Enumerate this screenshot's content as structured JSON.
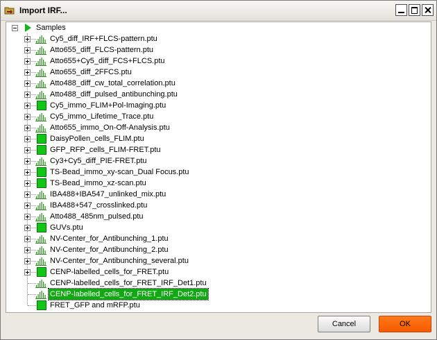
{
  "window": {
    "title": "Import IRF...",
    "icon": "folder-icon",
    "controls": [
      "minimize",
      "maximize",
      "close"
    ]
  },
  "tree": {
    "root": "Samples",
    "items": [
      {
        "label": "Cy5_diff_IRF+FLCS-pattern.ptu",
        "icon": "histogram-icon",
        "expandable": true
      },
      {
        "label": "Atto655_diff_FLCS-pattern.ptu",
        "icon": "histogram-icon",
        "expandable": true
      },
      {
        "label": "Atto655+Cy5_diff_FCS+FLCS.ptu",
        "icon": "histogram-icon",
        "expandable": true
      },
      {
        "label": "Atto655_diff_2FFCS.ptu",
        "icon": "histogram-icon",
        "expandable": true
      },
      {
        "label": "Atto488_diff_cw_total_correlation.ptu",
        "icon": "histogram-icon",
        "expandable": true
      },
      {
        "label": "Atto488_diff_pulsed_antibunching.ptu",
        "icon": "histogram-icon",
        "expandable": true
      },
      {
        "label": "Cy5_immo_FLIM+Pol-Imaging.ptu",
        "icon": "image-square-icon",
        "expandable": true
      },
      {
        "label": "Cy5_immo_Lifetime_Trace.ptu",
        "icon": "histogram-icon",
        "expandable": true
      },
      {
        "label": "Atto655_immo_On-Off-Analysis.ptu",
        "icon": "histogram-icon",
        "expandable": true
      },
      {
        "label": "DaisyPollen_cells_FLIM.ptu",
        "icon": "image-square-icon",
        "expandable": true
      },
      {
        "label": "GFP_RFP_cells_FLIM-FRET.ptu",
        "icon": "image-square-icon",
        "expandable": true
      },
      {
        "label": "Cy3+Cy5_diff_PIE-FRET.ptu",
        "icon": "histogram-icon",
        "expandable": true
      },
      {
        "label": "TS-Bead_immo_xy-scan_Dual Focus.ptu",
        "icon": "image-square-icon",
        "expandable": true
      },
      {
        "label": "TS-Bead_immo_xz-scan.ptu",
        "icon": "image-square-icon",
        "expandable": true
      },
      {
        "label": "IBA488+IBA547_unlinked_mix.ptu",
        "icon": "histogram-icon",
        "expandable": true
      },
      {
        "label": "IBA488+547_crosslinked.ptu",
        "icon": "histogram-icon",
        "expandable": true
      },
      {
        "label": "Atto488_485nm_pulsed.ptu",
        "icon": "histogram-icon",
        "expandable": true
      },
      {
        "label": "GUVs.ptu",
        "icon": "image-square-icon",
        "expandable": true
      },
      {
        "label": "NV-Center_for_Antibunching_1.ptu",
        "icon": "histogram-icon",
        "expandable": true
      },
      {
        "label": "NV-Center_for_Antibunching_2.ptu",
        "icon": "histogram-icon",
        "expandable": true
      },
      {
        "label": "NV-Center_for_Antibunching_several.ptu",
        "icon": "histogram-icon",
        "expandable": true
      },
      {
        "label": "CENP-labelled_cells_for_FRET.ptu",
        "icon": "image-square-icon",
        "expandable": true
      },
      {
        "label": "CENP-labelled_cells_for_FRET_IRF_Det1.ptu",
        "icon": "histogram-icon",
        "expandable": false
      },
      {
        "label": "CENP-labelled_cells_for_FRET_IRF_Det2.ptu",
        "icon": "histogram-icon",
        "expandable": false,
        "selected": true
      },
      {
        "label": "FRET_GFP and mRFP.ptu",
        "icon": "image-square-icon",
        "expandable": false
      }
    ]
  },
  "buttons": {
    "cancel": "Cancel",
    "ok": "OK"
  },
  "colors": {
    "selection": "#12a814",
    "icon_green": "#11c418",
    "ok_button": "#f55a00"
  }
}
